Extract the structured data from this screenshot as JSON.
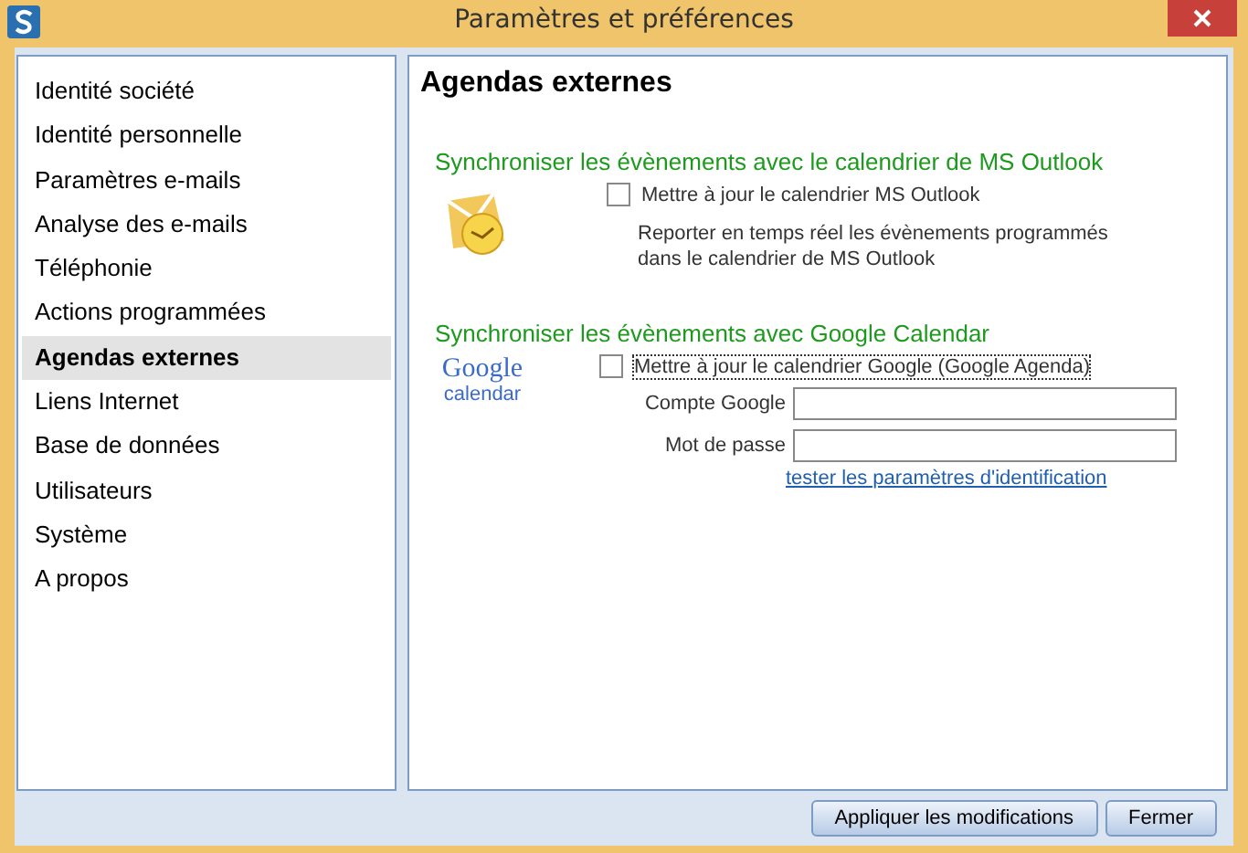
{
  "window": {
    "title": "Paramètres et préférences"
  },
  "sidebar": {
    "items": [
      {
        "label": "Identité société",
        "selected": false
      },
      {
        "label": "Identité personnelle",
        "selected": false
      },
      {
        "label": "Paramètres e-mails",
        "selected": false
      },
      {
        "label": "Analyse des e-mails",
        "selected": false
      },
      {
        "label": "Téléphonie",
        "selected": false
      },
      {
        "label": "Actions programmées",
        "selected": false
      },
      {
        "label": "Agendas externes",
        "selected": true
      },
      {
        "label": "Liens Internet",
        "selected": false
      },
      {
        "label": "Base de données",
        "selected": false
      },
      {
        "label": "Utilisateurs",
        "selected": false
      },
      {
        "label": "Système",
        "selected": false
      },
      {
        "label": "A propos",
        "selected": false
      }
    ]
  },
  "panel": {
    "title": "Agendas externes",
    "outlook": {
      "heading": "Synchroniser les évènements avec le calendrier de MS Outlook",
      "checkbox": {
        "label": "Mettre à jour le calendrier MS Outlook",
        "checked": false
      },
      "description": "Reporter en temps réel les évènements programmés dans le calendrier de MS Outlook"
    },
    "google": {
      "heading": "Synchroniser les évènements avec Google Calendar",
      "logo": {
        "word": "Google",
        "sub": "calendar"
      },
      "checkbox": {
        "label": "Mettre à jour le calendrier Google (Google Agenda)",
        "checked": false
      },
      "fields": [
        {
          "label": "Compte Google"
        },
        {
          "label": "Mot de passe"
        }
      ],
      "link": "tester les paramètres d'identification"
    }
  },
  "buttons": [
    "Appliquer les modifications",
    "Fermer"
  ]
}
